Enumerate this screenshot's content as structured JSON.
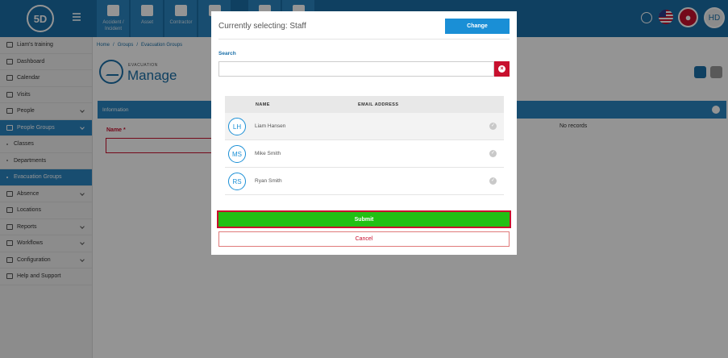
{
  "topbar": {
    "logo_text": "5D",
    "tiles": [
      {
        "label": "Accident / Incident",
        "icon": "first-aid-icon"
      },
      {
        "label": "Asset",
        "icon": "boxes-icon"
      },
      {
        "label": "Contractor",
        "icon": "hard-hat-icon"
      },
      {
        "label": "",
        "icon": "document-icon"
      },
      {
        "label": "",
        "icon": "person-icon"
      },
      {
        "label": "",
        "icon": "database-icon"
      }
    ],
    "user_initials": "HD"
  },
  "sidebar": {
    "items": [
      {
        "label": "Liam's training",
        "icon": "training-icon",
        "chevron": false
      },
      {
        "label": "Dashboard",
        "icon": "dashboard-icon",
        "chevron": false
      },
      {
        "label": "Calendar",
        "icon": "calendar-icon",
        "chevron": false
      },
      {
        "label": "Visits",
        "icon": "visits-icon",
        "chevron": false
      },
      {
        "label": "People",
        "icon": "people-icon",
        "chevron": true
      },
      {
        "label": "People Groups",
        "icon": "people-groups-icon",
        "chevron": true
      },
      {
        "label": "Classes",
        "icon": "",
        "chevron": false
      },
      {
        "label": "Departments",
        "icon": "",
        "chevron": false
      },
      {
        "label": "Evacuation Groups",
        "icon": "",
        "chevron": false
      },
      {
        "label": "Absence",
        "icon": "absence-icon",
        "chevron": true
      },
      {
        "label": "Locations",
        "icon": "locations-icon",
        "chevron": false
      },
      {
        "label": "Reports",
        "icon": "reports-icon",
        "chevron": true
      },
      {
        "label": "Workflows",
        "icon": "workflows-icon",
        "chevron": true
      },
      {
        "label": "Configuration",
        "icon": "configuration-icon",
        "chevron": true
      },
      {
        "label": "Help and Support",
        "icon": "help-icon",
        "chevron": false
      }
    ]
  },
  "breadcrumb": {
    "items": [
      "Home",
      "Groups",
      "Evacuation Groups"
    ]
  },
  "page": {
    "small_title": "EVACUATION",
    "big_title": "Manage",
    "info_bar": "Information",
    "name_label": "Name *",
    "no_records": "No records"
  },
  "modal": {
    "title": "Currently selecting:  Staff",
    "change_label": "Change",
    "search_label": "Search",
    "search_value": "",
    "table": {
      "col_name": "NAME",
      "col_email": "EMAIL ADDRESS",
      "rows": [
        {
          "initials": "LH",
          "name": "Liam Hansen",
          "email": ""
        },
        {
          "initials": "MS",
          "name": "Mike Smith",
          "email": ""
        },
        {
          "initials": "RS",
          "name": "Ryan Smith",
          "email": ""
        }
      ]
    },
    "submit_label": "Submit",
    "cancel_label": "Cancel"
  },
  "colors": {
    "brand": "#1a6fa8",
    "accent": "#2a86c2",
    "submit": "#22c014",
    "danger": "#c8102e"
  }
}
